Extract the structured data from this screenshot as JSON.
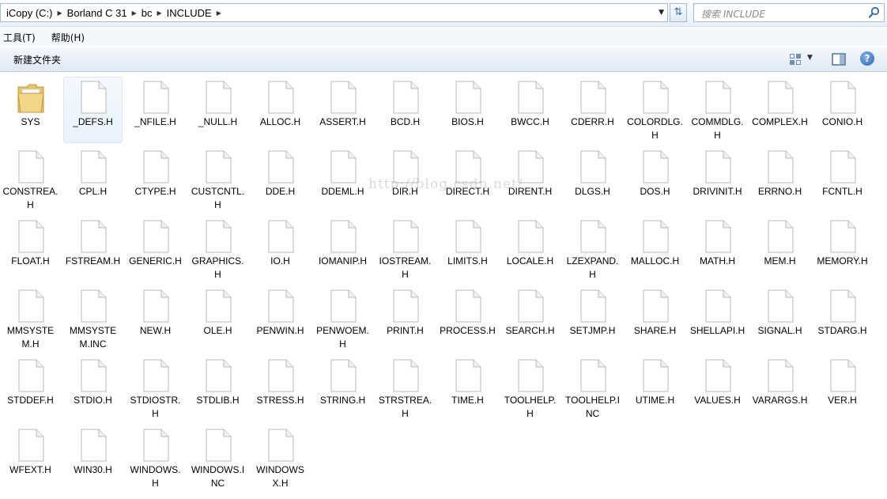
{
  "address": {
    "crumbs": [
      "iCopy (C:)",
      "Borland C 31",
      "bc",
      "INCLUDE"
    ]
  },
  "search": {
    "placeholder": "搜索 INCLUDE"
  },
  "menu": {
    "items": [
      "工具(T)",
      "帮助(H)"
    ]
  },
  "toolbar": {
    "new_folder_label": "新建文件夹"
  },
  "files": [
    "SYS",
    "_DEFS.H",
    "_NFILE.H",
    "_NULL.H",
    "ALLOC.H",
    "ASSERT.H",
    "BCD.H",
    "BIOS.H",
    "BWCC.H",
    "CDERR.H",
    "COLORDLG.H",
    "COMMDLG.H",
    "COMPLEX.H",
    "CONIO.H",
    "CONSTREA.H",
    "CPL.H",
    "CTYPE.H",
    "CUSTCNTL.H",
    "DDE.H",
    "DDEML.H",
    "DIR.H",
    "DIRECT.H",
    "DIRENT.H",
    "DLGS.H",
    "DOS.H",
    "DRIVINIT.H",
    "ERRNO.H",
    "FCNTL.H",
    "FLOAT.H",
    "FSTREAM.H",
    "GENERIC.H",
    "GRAPHICS.H",
    "IO.H",
    "IOMANIP.H",
    "IOSTREAM.H",
    "LIMITS.H",
    "LOCALE.H",
    "LZEXPAND.H",
    "MALLOC.H",
    "MATH.H",
    "MEM.H",
    "MEMORY.H",
    "MMSYSTEM.H",
    "MMSYSTEM.INC",
    "NEW.H",
    "OLE.H",
    "PENWIN.H",
    "PENWOEM.H",
    "PRINT.H",
    "PROCESS.H",
    "SEARCH.H",
    "SETJMP.H",
    "SHARE.H",
    "SHELLAPI.H",
    "SIGNAL.H",
    "STDARG.H",
    "STDDEF.H",
    "STDIO.H",
    "STDIOSTR.H",
    "STDLIB.H",
    "STRESS.H",
    "STRING.H",
    "STRSTREA.H",
    "TIME.H",
    "TOOLHELP.H",
    "TOOLHELP.INC",
    "UTIME.H",
    "VALUES.H",
    "VARARGS.H",
    "VER.H",
    "WFEXT.H",
    "WIN30.H",
    "WINDOWS.H",
    "WINDOWS.INC",
    "WINDOWSX.H"
  ],
  "folder_items": [
    "SYS"
  ],
  "selected_item": "_DEFS.H",
  "watermark": "http://blog.csdn.net/",
  "colors": {
    "accent": "#3a6aa8",
    "selection": "#eaf2fb",
    "toolbar_bg": "#dfe8f4"
  }
}
